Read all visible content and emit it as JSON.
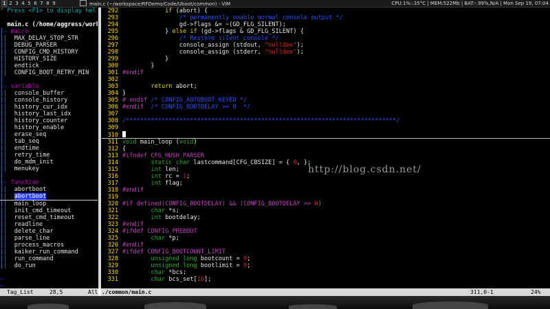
{
  "topbar": {
    "workspaces": [
      "1",
      "2",
      "3",
      "4",
      "5",
      "6",
      "7",
      "8",
      "9"
    ],
    "active_workspace_index": 0,
    "window_title": "main.c (~/workspace/RFDemo/Code/Uboot/common) - VIM",
    "sysinfo": "CPU:1%::35°C | MEM:522Mb | BAT:-.99%,N/A | Mon Sep 19, 07:04"
  },
  "taglist": {
    "help": "\" Press <F1> to display hel",
    "file": "main.c (/home/aggress/work",
    "lines": [
      {
        "fold": "|-",
        "text": "macro",
        "kind": "kind"
      },
      {
        "fold": "||",
        "text": "MAX_DELAY_STOP_STR",
        "kind": "item"
      },
      {
        "fold": "||",
        "text": "DEBUG_PARSER",
        "kind": "item"
      },
      {
        "fold": "||",
        "text": "CONFIG_CMD_HISTORY",
        "kind": "item"
      },
      {
        "fold": "||",
        "text": "HISTORY_SIZE",
        "kind": "item"
      },
      {
        "fold": "||",
        "text": "endtick",
        "kind": "item"
      },
      {
        "fold": "||",
        "text": "CONFIG_BOOT_RETRY_MIN",
        "kind": "item"
      },
      {
        "fold": "|",
        "text": "",
        "kind": "item"
      },
      {
        "fold": "|-",
        "text": "variable",
        "kind": "kind"
      },
      {
        "fold": "||",
        "text": "console_buffer",
        "kind": "item"
      },
      {
        "fold": "||",
        "text": "console_history",
        "kind": "item"
      },
      {
        "fold": "||",
        "text": "history_cur_idx",
        "kind": "item"
      },
      {
        "fold": "||",
        "text": "history_last_idx",
        "kind": "item"
      },
      {
        "fold": "||",
        "text": "history_counter",
        "kind": "item"
      },
      {
        "fold": "||",
        "text": "history_enable",
        "kind": "item"
      },
      {
        "fold": "||",
        "text": "erase_seq",
        "kind": "item"
      },
      {
        "fold": "||",
        "text": "tab_seq",
        "kind": "item"
      },
      {
        "fold": "||",
        "text": "endtime",
        "kind": "item"
      },
      {
        "fold": "||",
        "text": "retry_time",
        "kind": "item"
      },
      {
        "fold": "||",
        "text": "do_mdm_init",
        "kind": "item"
      },
      {
        "fold": "||",
        "text": "menukey",
        "kind": "item"
      },
      {
        "fold": "|",
        "text": "",
        "kind": "item"
      },
      {
        "fold": "|-",
        "text": "function",
        "kind": "kind"
      },
      {
        "fold": "||",
        "text": "abortboot",
        "kind": "item"
      },
      {
        "fold": "||",
        "text": "abortboot",
        "kind": "selected"
      },
      {
        "fold": "||",
        "text": "main_loop",
        "kind": "item"
      },
      {
        "fold": "||",
        "text": "init_cmd_timeout",
        "kind": "item"
      },
      {
        "fold": "||",
        "text": "reset_cmd_timeout",
        "kind": "item"
      },
      {
        "fold": "||",
        "text": "readline",
        "kind": "item"
      },
      {
        "fold": "||",
        "text": "delete_char",
        "kind": "item"
      },
      {
        "fold": "||",
        "text": "parse_line",
        "kind": "item"
      },
      {
        "fold": "||",
        "text": "process_macros",
        "kind": "item"
      },
      {
        "fold": "||",
        "text": "kaiker_run_command",
        "kind": "item"
      },
      {
        "fold": "||",
        "text": "run_command",
        "kind": "item"
      },
      {
        "fold": "||",
        "text": "do_run",
        "kind": "item"
      },
      {
        "fold": "",
        "text": "",
        "kind": "item"
      },
      {
        "fold": "~",
        "text": "",
        "kind": "tilde"
      },
      {
        "fold": "~",
        "text": "",
        "kind": "tilde"
      }
    ]
  },
  "code": {
    "lines": [
      {
        "n": "292",
        "tokens": [
          [
            "            ",
            ""
          ],
          [
            "if",
            "kw"
          ],
          [
            " (abort) {",
            ""
          ]
        ]
      },
      {
        "n": "293",
        "tokens": [
          [
            "                ",
            ""
          ],
          [
            "/* permanently enable normal console output */",
            "cm"
          ]
        ]
      },
      {
        "n": "294",
        "tokens": [
          [
            "                gd->flags &= ~(GD_FLG_SILENT);",
            ""
          ]
        ]
      },
      {
        "n": "295",
        "tokens": [
          [
            "            } ",
            ""
          ],
          [
            "else",
            "kw"
          ],
          [
            " ",
            ""
          ],
          [
            "if",
            "kw"
          ],
          [
            " (gd->flags & GD_FLG_SILENT) {",
            ""
          ]
        ]
      },
      {
        "n": "296",
        "tokens": [
          [
            "                ",
            ""
          ],
          [
            "/* Restore silent console */",
            "cm"
          ]
        ]
      },
      {
        "n": "297",
        "tokens": [
          [
            "                console_assign (stdout, ",
            ""
          ],
          [
            "\"nulldev\"",
            "str"
          ],
          [
            ");",
            ""
          ]
        ]
      },
      {
        "n": "298",
        "tokens": [
          [
            "                console_assign (stderr, ",
            ""
          ],
          [
            "\"nulldev\"",
            "str"
          ],
          [
            ");",
            ""
          ]
        ]
      },
      {
        "n": "299",
        "tokens": [
          [
            "            }",
            ""
          ]
        ]
      },
      {
        "n": "300",
        "tokens": [
          [
            "        }",
            ""
          ]
        ]
      },
      {
        "n": "301",
        "tokens": [
          [
            "#endif",
            "pp"
          ]
        ]
      },
      {
        "n": "302",
        "tokens": [
          [
            "",
            ""
          ]
        ]
      },
      {
        "n": "303",
        "tokens": [
          [
            "        ",
            ""
          ],
          [
            "return",
            "kw"
          ],
          [
            " abort;",
            ""
          ]
        ]
      },
      {
        "n": "304",
        "tokens": [
          [
            "}",
            ""
          ]
        ]
      },
      {
        "n": "305",
        "tokens": [
          [
            "# endif",
            "pp"
          ],
          [
            " ",
            ""
          ],
          [
            "/* CONFIG_AUTOBOOT_KEYED */",
            "cm"
          ]
        ]
      },
      {
        "n": "306",
        "tokens": [
          [
            "#endif",
            "pp"
          ],
          [
            "  ",
            ""
          ],
          [
            "/* CONFIG_BOOTDELAY >= 0  */",
            "cm"
          ]
        ]
      },
      {
        "n": "307",
        "tokens": [
          [
            "",
            ""
          ]
        ]
      },
      {
        "n": "308",
        "tokens": [
          [
            "/****************************************************************************/",
            "cm"
          ]
        ]
      },
      {
        "n": "309",
        "tokens": [
          [
            "",
            ""
          ]
        ]
      },
      {
        "n": "310",
        "tokens": [
          [
            "",
            ""
          ]
        ],
        "cursor": true
      },
      {
        "n": "311",
        "tokens": [
          [
            "void",
            "ty"
          ],
          [
            " main_loop (",
            ""
          ],
          [
            "void",
            "ty"
          ],
          [
            ")",
            ""
          ]
        ]
      },
      {
        "n": "312",
        "tokens": [
          [
            "{",
            ""
          ]
        ]
      },
      {
        "n": "313",
        "tokens": [
          [
            "#ifndef",
            "pp"
          ],
          [
            " CFG_HUSH_PARSER",
            "pp"
          ]
        ]
      },
      {
        "n": "314",
        "tokens": [
          [
            "        ",
            ""
          ],
          [
            "static",
            "ty"
          ],
          [
            " ",
            ""
          ],
          [
            "char",
            "ty"
          ],
          [
            " lastcommand[CFG_CBSIZE] = { ",
            ""
          ],
          [
            "0",
            "num"
          ],
          [
            ", };",
            ""
          ]
        ]
      },
      {
        "n": "315",
        "tokens": [
          [
            "        ",
            ""
          ],
          [
            "int",
            "ty"
          ],
          [
            " len;",
            ""
          ]
        ]
      },
      {
        "n": "316",
        "tokens": [
          [
            "        ",
            ""
          ],
          [
            "int",
            "ty"
          ],
          [
            " rc = ",
            ""
          ],
          [
            "1",
            "num"
          ],
          [
            ";",
            ""
          ]
        ]
      },
      {
        "n": "317",
        "tokens": [
          [
            "        ",
            ""
          ],
          [
            "int",
            "ty"
          ],
          [
            " flag;",
            ""
          ]
        ]
      },
      {
        "n": "318",
        "tokens": [
          [
            "#endif",
            "pp"
          ]
        ]
      },
      {
        "n": "319",
        "tokens": [
          [
            "",
            ""
          ]
        ]
      },
      {
        "n": "320",
        "tokens": [
          [
            "#if defined(CONFIG_BOOTDELAY) && (CONFIG_BOOTDELAY >= ",
            "pp"
          ],
          [
            "0",
            "num"
          ],
          [
            ")",
            "pp"
          ]
        ]
      },
      {
        "n": "321",
        "tokens": [
          [
            "        ",
            ""
          ],
          [
            "char",
            "ty"
          ],
          [
            " *s;",
            ""
          ]
        ]
      },
      {
        "n": "322",
        "tokens": [
          [
            "        ",
            ""
          ],
          [
            "int",
            "ty"
          ],
          [
            " bootdelay;",
            ""
          ]
        ]
      },
      {
        "n": "323",
        "tokens": [
          [
            "#endif",
            "pp"
          ]
        ]
      },
      {
        "n": "324",
        "tokens": [
          [
            "#ifdef",
            "pp"
          ],
          [
            " CONFIG_PREBOOT",
            "pp"
          ]
        ]
      },
      {
        "n": "325",
        "tokens": [
          [
            "        ",
            ""
          ],
          [
            "char",
            "ty"
          ],
          [
            " *p;",
            ""
          ]
        ]
      },
      {
        "n": "326",
        "tokens": [
          [
            "#endif",
            "pp"
          ]
        ]
      },
      {
        "n": "327",
        "tokens": [
          [
            "#ifdef",
            "pp"
          ],
          [
            " CONFIG_BOOTCOUNT_LIMIT",
            "pp"
          ]
        ]
      },
      {
        "n": "328",
        "tokens": [
          [
            "        ",
            ""
          ],
          [
            "unsigned",
            "ty"
          ],
          [
            " ",
            ""
          ],
          [
            "long",
            "ty"
          ],
          [
            " bootcount = ",
            ""
          ],
          [
            "0",
            "num"
          ],
          [
            ";",
            ""
          ]
        ]
      },
      {
        "n": "329",
        "tokens": [
          [
            "        ",
            ""
          ],
          [
            "unsigned",
            "ty"
          ],
          [
            " ",
            ""
          ],
          [
            "long",
            "ty"
          ],
          [
            " bootlimit = ",
            ""
          ],
          [
            "0",
            "num"
          ],
          [
            ";",
            ""
          ]
        ]
      },
      {
        "n": "330",
        "tokens": [
          [
            "        ",
            ""
          ],
          [
            "char",
            "ty"
          ],
          [
            " *bcs;",
            ""
          ]
        ]
      },
      {
        "n": "331",
        "tokens": [
          [
            "        ",
            ""
          ],
          [
            "char",
            "ty"
          ],
          [
            " bcs_set[",
            ""
          ],
          [
            "16",
            "num"
          ],
          [
            "];",
            ""
          ]
        ]
      }
    ]
  },
  "watermark": "http://blog.csdn.net/",
  "status": {
    "left_name": "Tag_List",
    "left_pos": "28,5",
    "left_all": "All",
    "filename": "./common/main.c",
    "right_pos": "311,0-1",
    "right_pct": "24%"
  },
  "colors": {
    "line_number": "#ffd900",
    "preprocessor": "#c040c0",
    "keyword": "#e8d000",
    "type": "#2aa822",
    "comment": "#2a50ff",
    "constant": "#e02020",
    "selection": "#2a40ff"
  }
}
